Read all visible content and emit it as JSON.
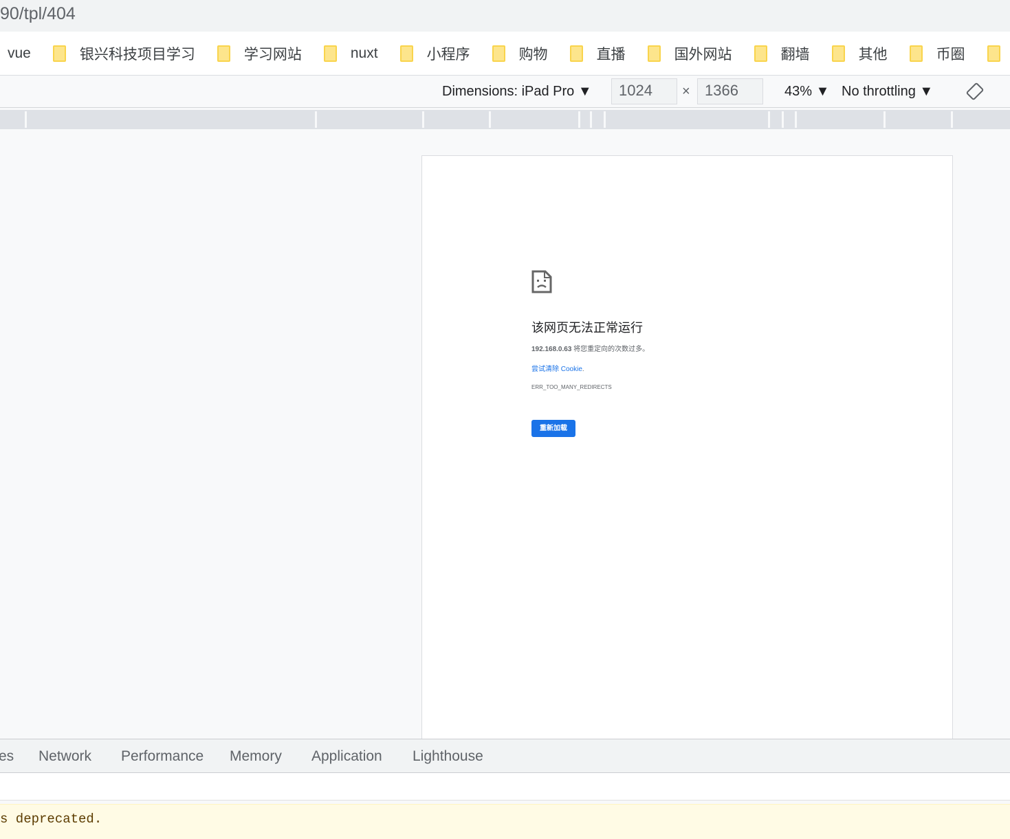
{
  "address_bar": {
    "url_fragment": "90/tpl/404"
  },
  "bookmarks": [
    {
      "label": "vue",
      "folder": false
    },
    {
      "label": "银兴科技项目学习",
      "folder": true
    },
    {
      "label": "学习网站",
      "folder": true
    },
    {
      "label": "nuxt",
      "folder": true
    },
    {
      "label": "小程序",
      "folder": true
    },
    {
      "label": "购物",
      "folder": true
    },
    {
      "label": "直播",
      "folder": true
    },
    {
      "label": "国外网站",
      "folder": true
    },
    {
      "label": "翻墙",
      "folder": true
    },
    {
      "label": "其他",
      "folder": true
    },
    {
      "label": "币圈",
      "folder": true
    }
  ],
  "device_toolbar": {
    "dimensions_label": "Dimensions: iPad Pro ▼",
    "width": "1024",
    "times": "×",
    "height": "1366",
    "zoom": "43% ▼",
    "throttling": "No throttling ▼"
  },
  "error_page": {
    "title": "该网页无法正常运行",
    "host": "192.168.0.63",
    "message": " 将您重定向的次数过多。",
    "link": "尝试清除 Cookie",
    "link_suffix": ".",
    "code": "ERR_TOO_MANY_REDIRECTS",
    "reload": "重新加载"
  },
  "devtools_tabs": [
    "es",
    "Network",
    "Performance",
    "Memory",
    "Application",
    "Lighthouse"
  ],
  "console": {
    "warning": "s deprecated."
  }
}
